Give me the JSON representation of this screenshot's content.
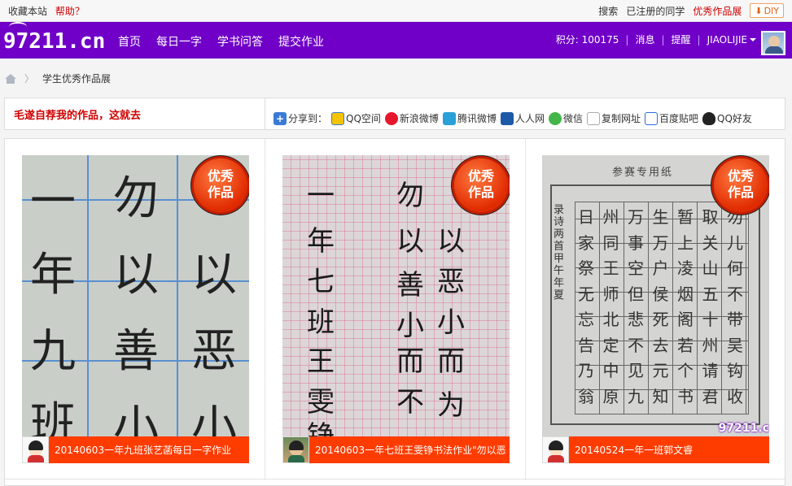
{
  "topbar": {
    "bookmark": "收藏本站",
    "help": "帮助？",
    "search": "搜索",
    "registered": "已注册的同学",
    "showcase": "优秀作品展",
    "diy": "DIY"
  },
  "nav": {
    "logo": "97211.cn",
    "links": [
      "首页",
      "每日一字",
      "学书问答",
      "提交作业"
    ],
    "points": "积分: 100175",
    "messages": "消息",
    "reminders": "提醒",
    "username": "JIAOLIJIE"
  },
  "breadcrumb": {
    "current": "学生优秀作品展"
  },
  "sharebar": {
    "slogan": "毛遂自荐我的作品，这就去",
    "label": "分享到：",
    "targets": [
      "QQ空间",
      "新浪微博",
      "腾讯微博",
      "人人网",
      "微信",
      "复制网址",
      "百度贴吧",
      "QQ好友"
    ]
  },
  "works": [
    {
      "badge_line1": "优秀",
      "badge_line2": "作品",
      "title": "20140603一年九班张艺菡每日一字作业",
      "glyphs": [
        "一",
        "勿",
        "年",
        "以",
        "以",
        "九",
        "善",
        "恶",
        "班",
        "小",
        "小"
      ]
    },
    {
      "badge_line1": "优秀",
      "badge_line2": "作品",
      "title": "20140603一年七班王雯铮书法作业\"勿以恶",
      "glyphs": [
        "一",
        "勿",
        "年",
        "以",
        "以",
        "七",
        "善",
        "恶",
        "班",
        "小",
        "小",
        "王",
        "而",
        "而",
        "雯",
        "不",
        "为",
        "铮"
      ]
    },
    {
      "badge_line1": "优秀",
      "badge_line2": "作品",
      "title": "20140524一年一班郭文睿",
      "paper_title": "参赛专用纸",
      "side_text": "录诗两首甲午年夏",
      "watermark": "97211.c",
      "glyphs": [
        "日",
        "州",
        "万",
        "生",
        "暂",
        "取",
        "勿",
        "家",
        "同",
        "事",
        "万",
        "上",
        "关",
        "儿",
        "祭",
        "王",
        "空",
        "户",
        "凌",
        "山",
        "何",
        "无",
        "师",
        "但",
        "侯",
        "烟",
        "五",
        "不",
        "忘",
        "北",
        "悲",
        "死",
        "阁",
        "十",
        "带",
        "告",
        "定",
        "不",
        "去",
        "若",
        "州",
        "吴",
        "乃",
        "中",
        "见",
        "元",
        "个",
        "请",
        "钩",
        "翁",
        "原",
        "九",
        "知",
        "书",
        "君",
        "收"
      ]
    }
  ]
}
